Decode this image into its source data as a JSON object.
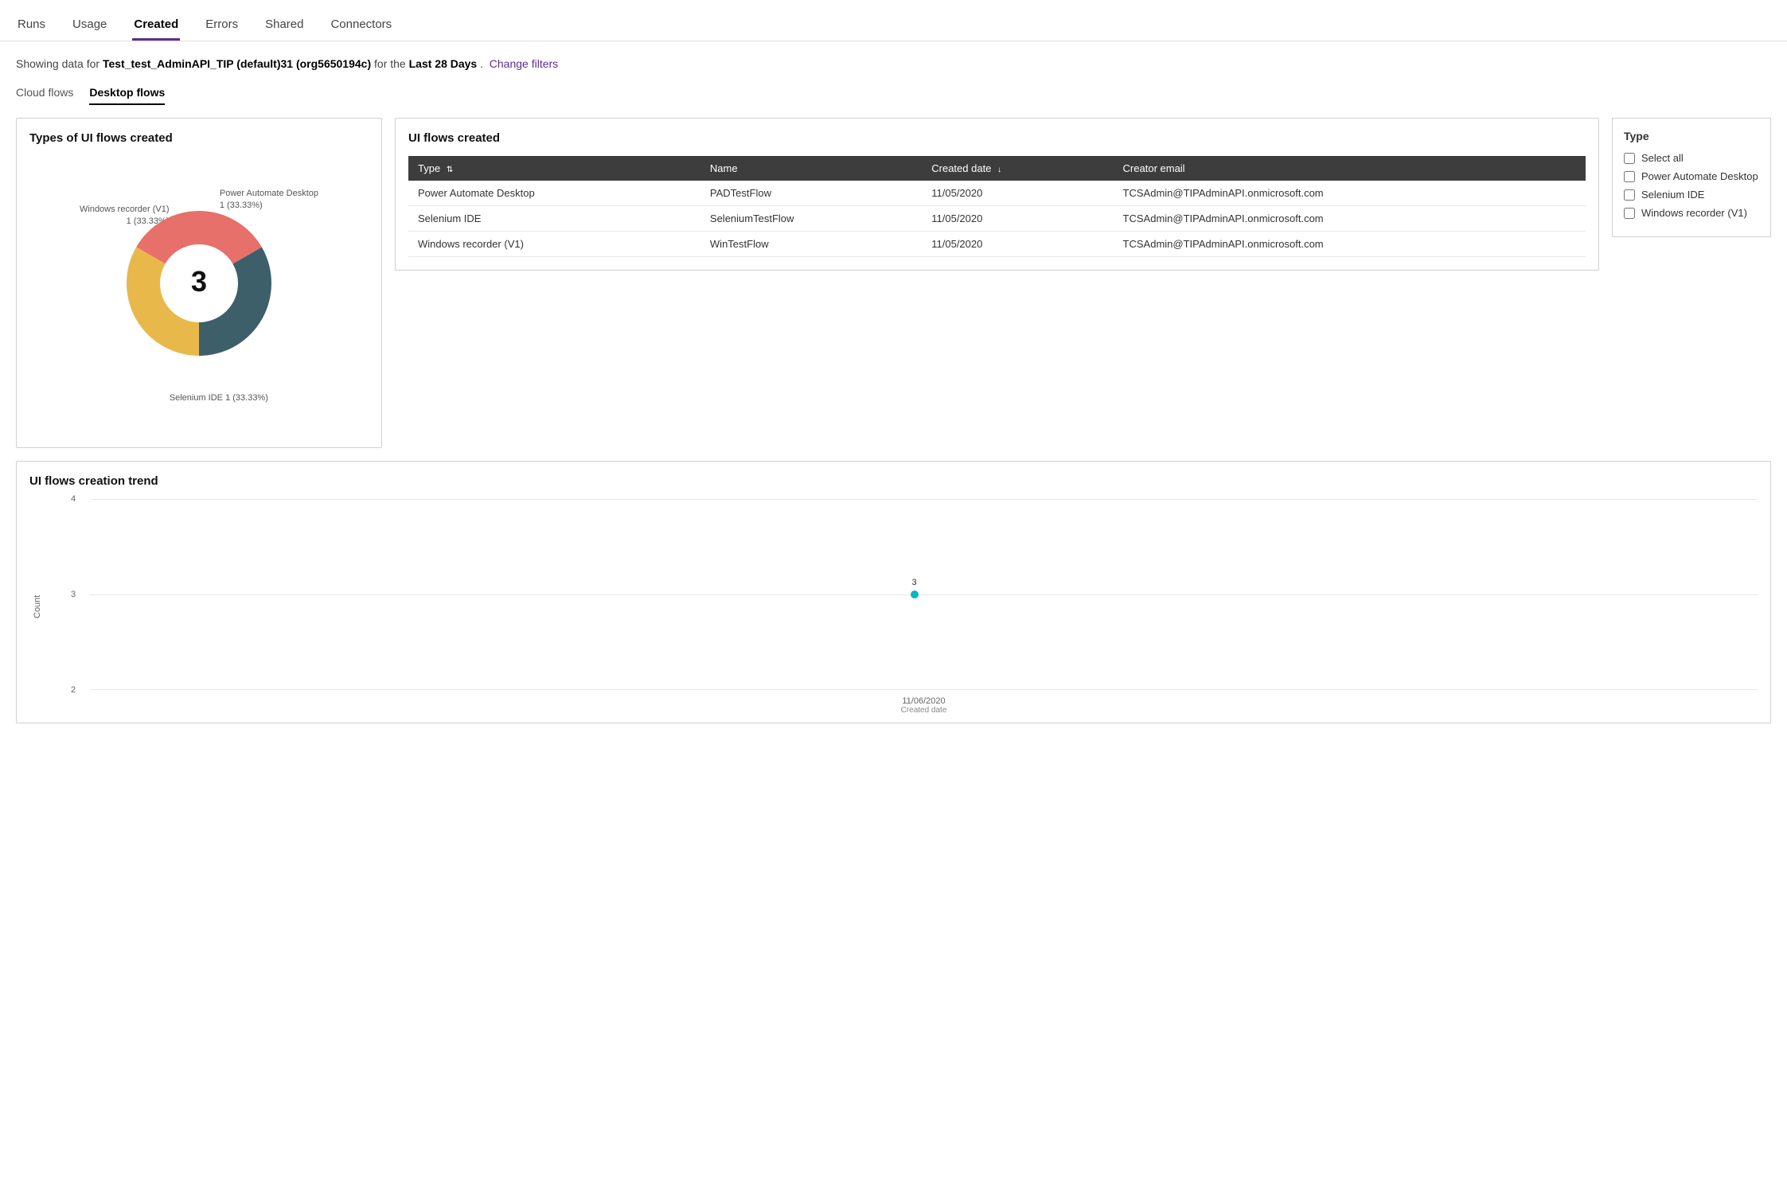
{
  "nav": {
    "items": [
      {
        "id": "runs",
        "label": "Runs",
        "active": false
      },
      {
        "id": "usage",
        "label": "Usage",
        "active": false
      },
      {
        "id": "created",
        "label": "Created",
        "active": true
      },
      {
        "id": "errors",
        "label": "Errors",
        "active": false
      },
      {
        "id": "shared",
        "label": "Shared",
        "active": false
      },
      {
        "id": "connectors",
        "label": "Connectors",
        "active": false
      }
    ]
  },
  "info_bar": {
    "prefix": "Showing data for ",
    "env_name": "Test_test_AdminAPI_TIP (default)31 (org5650194c)",
    "middle": " for the ",
    "period": "Last 28 Days",
    "suffix": ".",
    "change_filters": "Change filters"
  },
  "sub_tabs": [
    {
      "id": "cloud-flows",
      "label": "Cloud flows",
      "active": false
    },
    {
      "id": "desktop-flows",
      "label": "Desktop flows",
      "active": true
    }
  ],
  "donut_chart": {
    "title": "Types of UI flows created",
    "center_value": "3",
    "segments": [
      {
        "color": "#3d5f6a",
        "percentage": 33.33,
        "label": "Power Automate Desktop",
        "count": 1
      },
      {
        "color": "#e8b84b",
        "percentage": 33.33,
        "label": "Windows recorder (V1)",
        "count": 1
      },
      {
        "color": "#e8706a",
        "percentage": 33.33,
        "label": "Selenium IDE",
        "count": 1
      }
    ],
    "labels": {
      "top_left": "Windows recorder (V1)\n1 (33.33%)",
      "top_right": "Power Automate Desktop\n1 (33.33%)",
      "bottom": "Selenium IDE 1 (33.33%)"
    }
  },
  "table": {
    "title": "UI flows created",
    "columns": [
      {
        "id": "type",
        "label": "Type",
        "sortable": true
      },
      {
        "id": "name",
        "label": "Name",
        "sortable": false
      },
      {
        "id": "created_date",
        "label": "Created date",
        "sortable": true,
        "sort_active": true,
        "sort_dir": "desc"
      },
      {
        "id": "creator_email",
        "label": "Creator email",
        "sortable": false
      }
    ],
    "rows": [
      {
        "type": "Power Automate Desktop",
        "name": "PADTestFlow",
        "created_date": "11/05/2020",
        "creator_email": "TCSAdmin@TIPAdminAPI.onmicrosoft.com"
      },
      {
        "type": "Selenium IDE",
        "name": "SeleniumTestFlow",
        "created_date": "11/05/2020",
        "creator_email": "TCSAdmin@TIPAdminAPI.onmicrosoft.com"
      },
      {
        "type": "Windows recorder (V1)",
        "name": "WinTestFlow",
        "created_date": "11/05/2020",
        "creator_email": "TCSAdmin@TIPAdminAPI.onmicrosoft.com"
      }
    ]
  },
  "filter": {
    "title": "Type",
    "select_all_label": "Select all",
    "items": [
      {
        "id": "power-automate-desktop",
        "label": "Power Automate Desktop",
        "checked": false
      },
      {
        "id": "selenium-ide",
        "label": "Selenium IDE",
        "checked": false
      },
      {
        "id": "windows-recorder-v1",
        "label": "Windows recorder (V1)",
        "checked": false
      }
    ]
  },
  "trend_chart": {
    "title": "UI flows creation trend",
    "y_axis_label": "Count",
    "y_max": 4,
    "y_min": 2,
    "data_points": [
      {
        "x_label": "11/06/2020",
        "y_value": 3,
        "label": "3"
      }
    ],
    "x_axis_sub_label": "Created date",
    "grid_lines": [
      2,
      3,
      4
    ]
  }
}
